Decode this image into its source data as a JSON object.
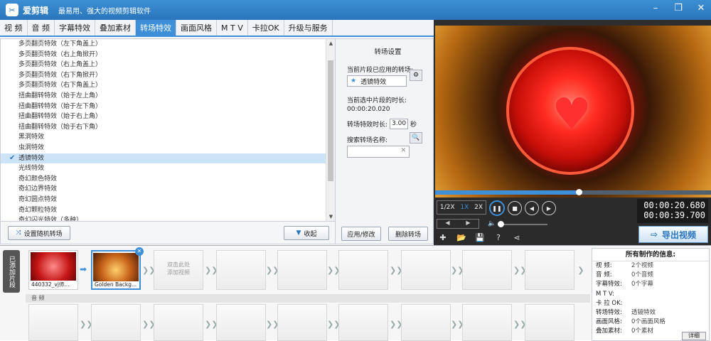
{
  "app": {
    "title": "爱剪辑",
    "slogan": "最易用、强大的视频剪辑软件",
    "window_buttons": [
      "minimize-icon",
      "restore-icon",
      "close-icon"
    ]
  },
  "tabs": [
    "视 频",
    "音 频",
    "字幕特效",
    "叠加素材",
    "转场特效",
    "画面风格",
    "M T V",
    "卡拉OK",
    "升级与服务"
  ],
  "active_tab": "转场特效",
  "transitions": [
    "多页翻页特效（左下角盖上）",
    "多页翻页特效（右上角掀开）",
    "多页翻页特效（右上角盖上）",
    "多页翻页特效（右下角掀开）",
    "多页翻页特效（右下角盖上）",
    "扭曲翻转特效（始于左上角）",
    "扭曲翻转特效（始于左下角）",
    "扭曲翻转特效（始于右上角）",
    "扭曲翻转特效（始于右下角）",
    "黑洞特效",
    "虫洞特效",
    "透镜特效",
    "光线特效",
    "奇幻颜色特效",
    "奇幻边界特效",
    "奇幻圆点特效",
    "奇幻颗粒特效",
    "奇幻闪光特效（多种）"
  ],
  "selected_transition_index": 11,
  "left_buttons": {
    "random": "设置随机转场",
    "collapse": "收起"
  },
  "settings": {
    "title": "转场设置",
    "applied_label": "当前片段已应用的转场:",
    "applied_value": "透镜特效",
    "clip_duration_label": "当前选中片段的时长:",
    "clip_duration_value": "00:00:20.020",
    "effect_duration_label": "转场特效时长:",
    "effect_duration_value": "3.00",
    "effect_duration_unit": "秒",
    "search_label": "搜索转场名称:",
    "search_value": "",
    "apply_button": "应用/修改",
    "delete_button": "删除转场"
  },
  "player": {
    "speeds": [
      "1/2X",
      "1X",
      "2X"
    ],
    "active_speed": "1X",
    "progress": 0.52,
    "volume": 0.0,
    "current_time": "00:00:20.680",
    "total_time": "00:00:39.700",
    "export_label": "导出视频"
  },
  "timeline": {
    "side_label": "已添加片段",
    "clips": [
      {
        "caption": "440332_vj师..."
      },
      {
        "caption": "Golden Backg..."
      }
    ],
    "empty_hint": "双击此处\n添加视频",
    "audio_label": "音 频"
  },
  "info": {
    "title": "所有制作的信息:",
    "rows": [
      {
        "key": "视    频:",
        "value": "2个视频"
      },
      {
        "key": "音    频:",
        "value": "0个音频"
      },
      {
        "key": "字幕特效:",
        "value": "0个字幕"
      },
      {
        "key": "M  T  V:",
        "value": ""
      },
      {
        "key": "卡 拉 OK:",
        "value": ""
      },
      {
        "key": "转场特效:",
        "value": "透镜特效"
      },
      {
        "key": "画面风格:",
        "value": "0个画面风格"
      },
      {
        "key": "叠加素材:",
        "value": "0个素材"
      }
    ],
    "detail_button": "详细"
  },
  "colors": {
    "accent": "#3d8fd8",
    "titlebar": "#2a75bb",
    "selection": "#cde4f8"
  }
}
